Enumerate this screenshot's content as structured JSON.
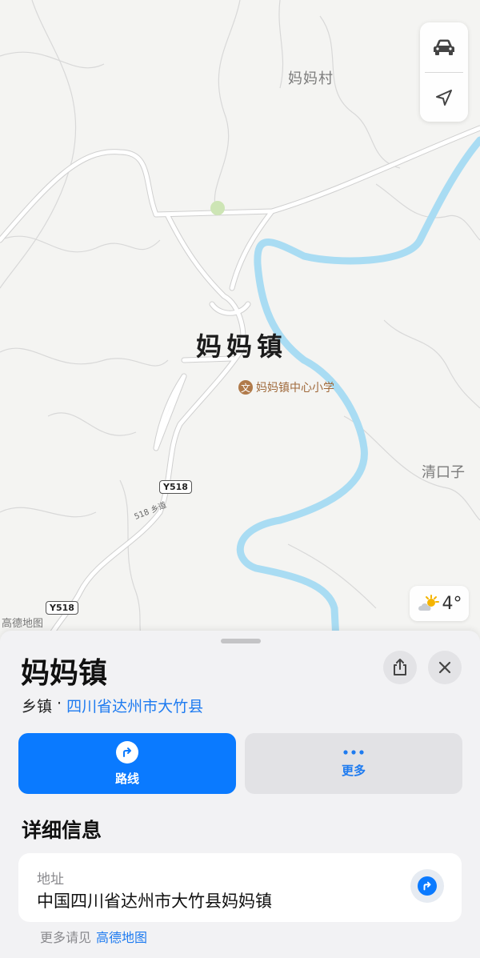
{
  "map": {
    "village_label": "妈妈村",
    "town_label": "妈妈镇",
    "poi": {
      "label": "妈妈镇中心小学",
      "icon": "school-icon",
      "icon_glyph": "文"
    },
    "east_label": "清口子",
    "road_sign_1": "Y518",
    "road_sign_2": "Y518",
    "road_name": "518 乡道",
    "watermark": "高德地图",
    "controls": {
      "drive_icon": "car-icon",
      "locate_icon": "location-arrow-icon"
    },
    "weather": {
      "icon": "partly-cloudy-icon",
      "temperature": "4°"
    },
    "colors": {
      "river": "#a9dcf3",
      "road": "#ffffff",
      "land": "#f4f4f2"
    }
  },
  "sheet": {
    "title": "妈妈镇",
    "category": "乡镇",
    "separator": "·",
    "region": "四川省达州市大竹县",
    "share_icon": "share-icon",
    "close_icon": "close-icon",
    "actions": {
      "route_label": "路线",
      "route_icon": "turn-right-arrow-icon",
      "more_label": "更多",
      "more_icon": "ellipsis-icon"
    },
    "section_title": "详细信息",
    "address_label": "地址",
    "address_value": "中国四川省达州市大竹县妈妈镇",
    "footer_prefix": "更多请见",
    "footer_link": "高德地图",
    "colors": {
      "accent": "#0a7aff",
      "link": "#1e7bf0"
    }
  }
}
